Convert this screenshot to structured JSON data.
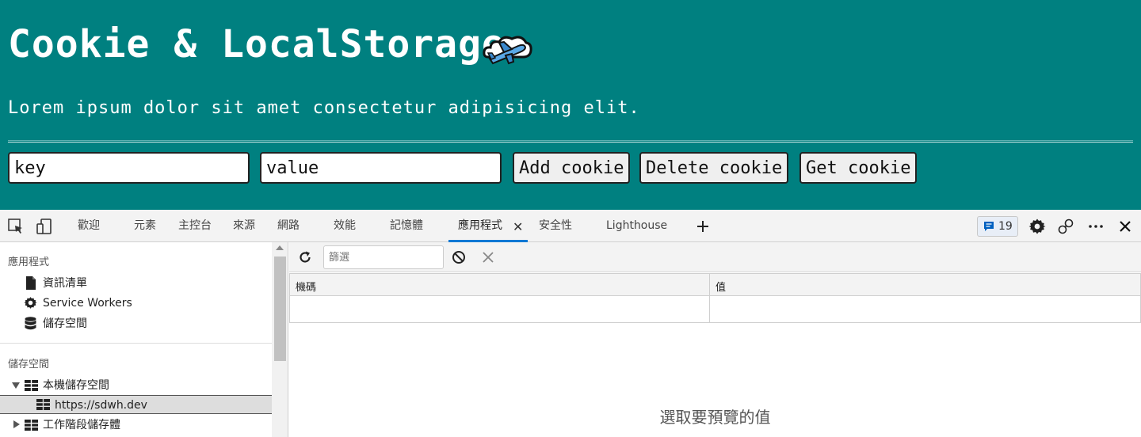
{
  "page": {
    "title": "Cookie & LocalStorage",
    "description": "Lorem ipsum dolor sit amet consectetur adipisicing elit.",
    "key_value": "key",
    "value_value": "value",
    "add_label": "Add cookie",
    "delete_label": "Delete cookie",
    "get_label": "Get cookie",
    "emoji_icon": "airplane-cloud-icon",
    "background": "#008080"
  },
  "devtools": {
    "tabs": [
      "歡迎",
      "元素",
      "主控台",
      "來源",
      "網路",
      "效能",
      "記憶體",
      "應用程式",
      "安全性",
      "Lighthouse"
    ],
    "active_tab": "應用程式",
    "issues_count": "19",
    "accent": "#0078d4"
  },
  "sidebar": {
    "section1_title": "應用程式",
    "app_items": [
      {
        "label": "資訊清單",
        "icon": "file-icon"
      },
      {
        "label": "Service Workers",
        "icon": "gear-icon"
      },
      {
        "label": "儲存空間",
        "icon": "database-icon"
      }
    ],
    "section2_title": "儲存空間",
    "local_storage": "本機儲存空間",
    "local_origin": "https://sdwh.dev",
    "session_storage": "工作階段儲存體"
  },
  "storage_view": {
    "filter_placeholder": "篩選",
    "col_key": "機碼",
    "col_value": "值",
    "preview_text": "選取要預覽的值"
  }
}
